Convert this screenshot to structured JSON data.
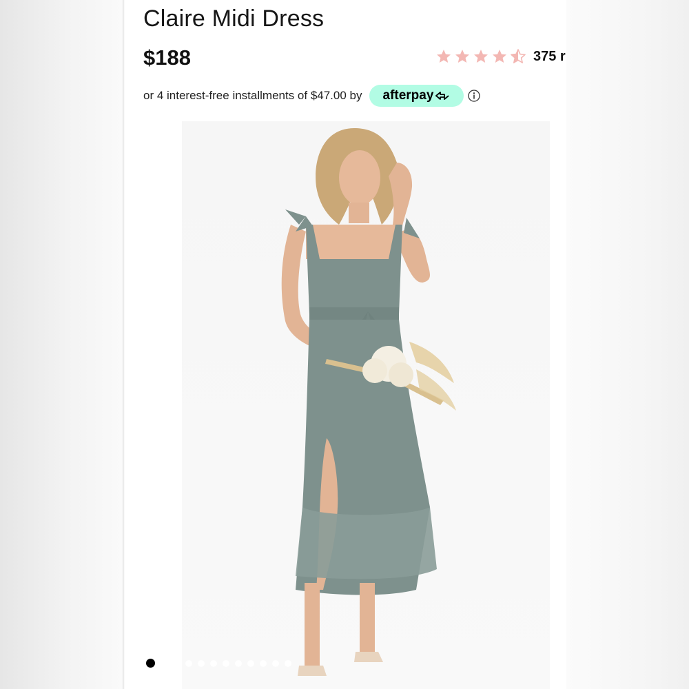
{
  "product": {
    "title": "Claire Midi Dress",
    "price": "$188",
    "rating": {
      "value": 4.5,
      "max": 5,
      "review_count_visible": "375 r",
      "star_color": "#f3b7b3"
    },
    "installments": {
      "text": "or 4 interest-free installments of $47.00 by",
      "provider_label": "afterpay",
      "badge_color": "#b2fce4"
    }
  },
  "gallery": {
    "image_description_icon": "product-photo",
    "dress_color": "#7e918d",
    "active_index": 0,
    "total": 12
  },
  "icons": {
    "info": "info-icon",
    "star": "star-icon",
    "afterpay_arrow": "afterpay-arrow-icon"
  }
}
